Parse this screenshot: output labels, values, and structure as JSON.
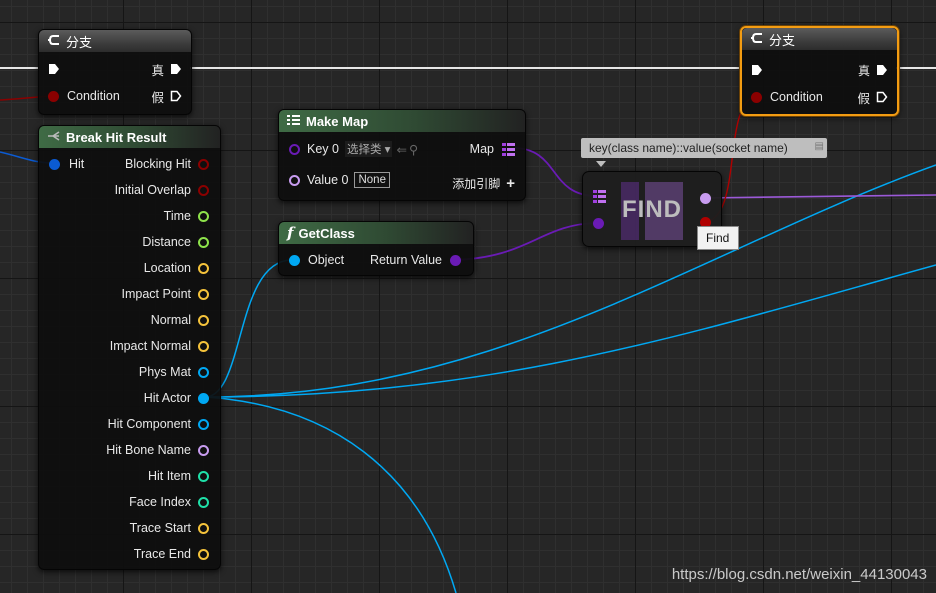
{
  "branch_node_left": {
    "title": "分支",
    "true_label": "真",
    "false_label": "假",
    "condition_label": "Condition"
  },
  "branch_node_right": {
    "title": "分支",
    "true_label": "真",
    "false_label": "假",
    "condition_label": "Condition"
  },
  "break_hit_result": {
    "title": "Break Hit Result",
    "input_label": "Hit",
    "outputs": [
      {
        "label": "Blocking Hit",
        "type": "bool"
      },
      {
        "label": "Initial Overlap",
        "type": "bool"
      },
      {
        "label": "Time",
        "type": "float"
      },
      {
        "label": "Distance",
        "type": "float"
      },
      {
        "label": "Location",
        "type": "vector"
      },
      {
        "label": "Impact Point",
        "type": "vector"
      },
      {
        "label": "Normal",
        "type": "vector"
      },
      {
        "label": "Impact Normal",
        "type": "vector"
      },
      {
        "label": "Phys Mat",
        "type": "object"
      },
      {
        "label": "Hit Actor",
        "type": "object"
      },
      {
        "label": "Hit Component",
        "type": "object"
      },
      {
        "label": "Hit Bone Name",
        "type": "name"
      },
      {
        "label": "Hit Item",
        "type": "int"
      },
      {
        "label": "Face Index",
        "type": "int"
      },
      {
        "label": "Trace Start",
        "type": "vector"
      },
      {
        "label": "Trace End",
        "type": "vector"
      }
    ]
  },
  "make_map": {
    "title": "Make Map",
    "key_label": "Key 0",
    "key_dropdown": "选择类",
    "value_label": "Value 0",
    "value_box": "None",
    "map_label": "Map",
    "add_pin_label": "添加引脚"
  },
  "get_class": {
    "title": "GetClass",
    "input_label": "Object",
    "output_label": "Return Value"
  },
  "find_node": {
    "title": "FIND"
  },
  "tooltip_key_value": "key(class name)::value(socket name)",
  "tooltip_find": "Find",
  "watermark": "https://blog.csdn.net/weixin_44130043",
  "colors": {
    "exec": "#ffffff",
    "bool": "#8b0000",
    "float": "#8ee34b",
    "vector": "#f5c33b",
    "object": "#00a8f3",
    "name": "#c89cf0",
    "int": "#1fe0a8",
    "class": "#6a1bb5",
    "selected": "#f39c12"
  }
}
